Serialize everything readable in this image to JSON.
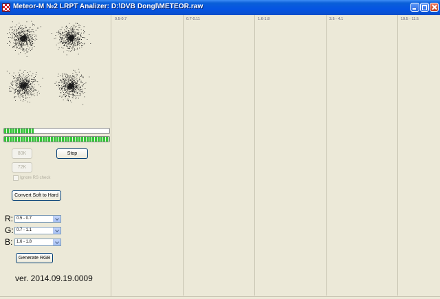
{
  "window": {
    "title": "Meteor-M №2 LRPT Analizer: D:\\DVB Dongl\\METEOR.raw"
  },
  "progress": {
    "signal_fraction": 0.29,
    "decode_fraction": 1.0
  },
  "buttons": {
    "b80k": "80K",
    "b72k": "72K",
    "stop": "Stop",
    "convert": "Convert Soft to Hard",
    "generate": "Generate RGB"
  },
  "checkbox": {
    "ignore_rs": "Ignore RS check",
    "checked": false
  },
  "rgb": {
    "r_label": "R:",
    "g_label": "G:",
    "b_label": "B:",
    "r_value": "0.5 - 0.7",
    "g_value": "0.7 - 1.1",
    "b_value": "1.6 - 1.8"
  },
  "version": "ver. 2014.09.19.0009",
  "channels": [
    "0.5-0.7",
    "0.7-0.11",
    "1.6-1.8",
    "3.5 - 4.1",
    "10.5 - 11.5"
  ],
  "colors": {
    "titlebar": "#0554e3",
    "window_bg": "#ece9d8",
    "progress_fill": "#36c43a",
    "close_button": "#c5421f"
  }
}
